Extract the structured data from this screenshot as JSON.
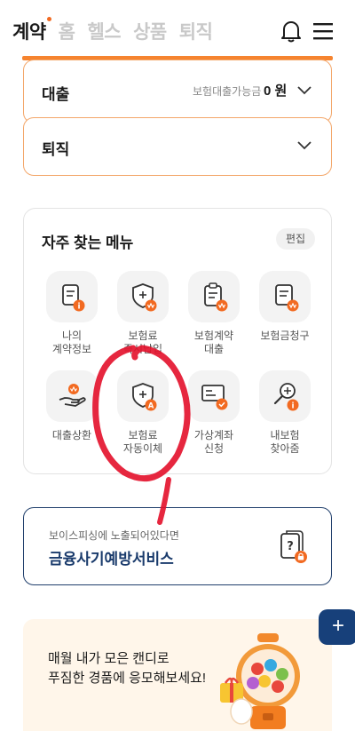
{
  "header": {
    "tabs": [
      {
        "label": "계약",
        "active": true
      },
      {
        "label": "홈",
        "active": false
      },
      {
        "label": "헬스",
        "active": false
      },
      {
        "label": "상품",
        "active": false
      },
      {
        "label": "퇴직",
        "active": false
      }
    ],
    "accent_color": "#f26a21"
  },
  "loan": {
    "title": "대출",
    "sub_label": "보험대출가능금",
    "amount": "0 원"
  },
  "retire": {
    "title": "퇴직"
  },
  "frequent": {
    "title": "자주 찾는 메뉴",
    "edit_label": "편집",
    "items": [
      {
        "label": "나의\n계약정보",
        "icon": "contract-info-icon"
      },
      {
        "label": "보험료\n즉시납입",
        "icon": "premium-instant-pay-icon"
      },
      {
        "label": "보험계약\n대출",
        "icon": "policy-loan-icon"
      },
      {
        "label": "보험금청구",
        "icon": "claim-icon"
      },
      {
        "label": "대출상환",
        "icon": "loan-repay-icon"
      },
      {
        "label": "보험료\n자동이체",
        "icon": "auto-transfer-icon"
      },
      {
        "label": "가상계좌\n신청",
        "icon": "virtual-account-icon"
      },
      {
        "label": "내보험\n찾아줌",
        "icon": "find-insurance-icon"
      }
    ]
  },
  "phishing": {
    "sub": "보이스피싱에 노출되어있다면",
    "title": "금융사기예방서비스",
    "brand_color": "#1a3b6c"
  },
  "fab": {
    "label": "+"
  },
  "candy": {
    "text": "매월 내가 모은 캔디로\n푸짐한 경품에 응모해보세요!"
  }
}
